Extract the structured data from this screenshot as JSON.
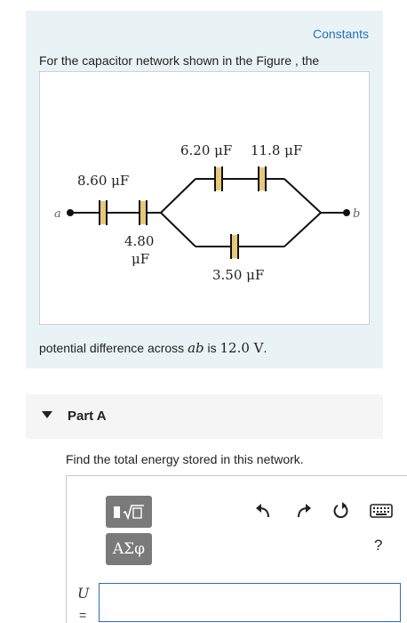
{
  "problem": {
    "constants_link": "Constants",
    "intro_text": "For the capacitor network shown in the Figure , the",
    "potential_prefix": "potential difference across ",
    "potential_var": "ab",
    "potential_mid": " is ",
    "potential_value": "12.0 V",
    "potential_suffix": "."
  },
  "figure": {
    "node_a": "a",
    "node_b": "b",
    "capacitors": {
      "c1": "8.60 μF",
      "c2_line1": "4.80",
      "c2_line2": "μF",
      "c3": "6.20 μF",
      "c4": "11.8 μF",
      "c5": "3.50 μF"
    }
  },
  "part": {
    "title": "Part A",
    "question": "Find the total energy stored in this network."
  },
  "answer": {
    "symbols_label": "ΑΣφ",
    "help_label": "?",
    "variable": "U",
    "equals": "=",
    "input_value": ""
  },
  "colors": {
    "accent": "#2c6fb7",
    "panel": "#e9f3f6",
    "capacitor_plate": "#e8c87a",
    "toolbar": "#7a7a7a"
  },
  "icons": {
    "templates": "templates-icon",
    "undo": "undo-icon",
    "redo": "redo-icon",
    "reset": "reset-icon",
    "keyboard": "keyboard-icon"
  }
}
